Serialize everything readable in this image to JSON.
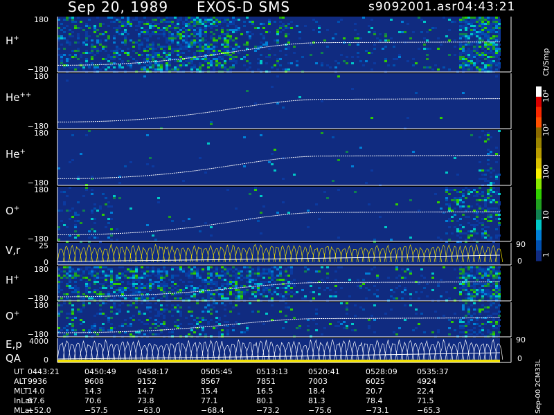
{
  "header": {
    "date": "Sep 20, 1989",
    "instrument": "EXOS-D SMS",
    "file": "s9092001.asr",
    "time": "04:43:21"
  },
  "chart_data": [
    {
      "type": "heatmap",
      "panels": [
        {
          "id": "h1",
          "label_base": "H",
          "label_sup": "+",
          "ytick_top": "180",
          "ytick_bottom": "−180",
          "ylim": [
            -180,
            180
          ]
        },
        {
          "id": "he2",
          "label_base": "He",
          "label_sup": "++",
          "ytick_top": "180",
          "ytick_bottom": "−180",
          "ylim": [
            -180,
            180
          ]
        },
        {
          "id": "he1",
          "label_base": "He",
          "label_sup": "+",
          "ytick_top": "180",
          "ytick_bottom": "−180",
          "ylim": [
            -180,
            180
          ]
        },
        {
          "id": "o1",
          "label_base": "O",
          "label_sup": "+",
          "ytick_top": "180",
          "ytick_bottom": "−180",
          "ylim": [
            -180,
            180
          ]
        },
        {
          "id": "vr",
          "label_base": "V,r",
          "label_sup": "",
          "ytick_top": "25",
          "ytick_bottom": "0",
          "ylim": [
            0,
            25
          ],
          "right_ticks": [
            "90",
            "0"
          ]
        },
        {
          "id": "h2",
          "label_base": "H",
          "label_sup": "+",
          "ytick_top": "180",
          "ytick_bottom": "−180",
          "ylim": [
            -180,
            180
          ]
        },
        {
          "id": "o2",
          "label_base": "O",
          "label_sup": "+",
          "ytick_top": "180",
          "ytick_bottom": "−180",
          "ylim": [
            -180,
            180
          ]
        },
        {
          "id": "ep",
          "label_base": "E,p",
          "label_sup": "",
          "label2": "QA",
          "ytick_top": "4000",
          "ytick_bottom": "0",
          "ylim": [
            0,
            4000
          ],
          "right_ticks": [
            "90",
            "0"
          ]
        }
      ],
      "colorbar": {
        "unit": "Ct/Smp",
        "tick_labels": [
          "10⁴",
          "10³",
          "100",
          "10",
          "1"
        ],
        "colors": [
          "#ffffff",
          "#d80000",
          "#f82800",
          "#ff5000",
          "#8a6a00",
          "#9a8400",
          "#b89c00",
          "#d8c000",
          "#f8f000",
          "#88e800",
          "#30d000",
          "#20a020",
          "#108050",
          "#00c8c8",
          "#0080d8",
          "#0050b0",
          "#102b80"
        ]
      }
    }
  ],
  "table": {
    "rows": [
      {
        "label": "UT",
        "values": [
          "0443:21",
          "0450:49",
          "0458:17",
          "0505:45",
          "0513:13",
          "0520:41",
          "0528:09",
          "0535:37"
        ]
      },
      {
        "label": "ALT",
        "values": [
          "9936",
          "9608",
          "9152",
          "8567",
          "7851",
          "7003",
          "6025",
          "4924"
        ]
      },
      {
        "label": "MLT",
        "values": [
          "14.0",
          "14.3",
          "14.7",
          "15.4",
          "16.5",
          "18.4",
          "20.7",
          "22.4"
        ]
      },
      {
        "label": "InLat",
        "values": [
          "67.6",
          "70.6",
          "73.8",
          "77.1",
          "80.1",
          "81.3",
          "78.4",
          "71.5"
        ]
      },
      {
        "label": "MLat",
        "values": [
          "−52.0",
          "−57.5",
          "−63.0",
          "−68.4",
          "−73.2",
          "−75.6",
          "−73.1",
          "−65.3"
        ]
      }
    ]
  },
  "footer_vertical": "Sep-00 2CM33L"
}
